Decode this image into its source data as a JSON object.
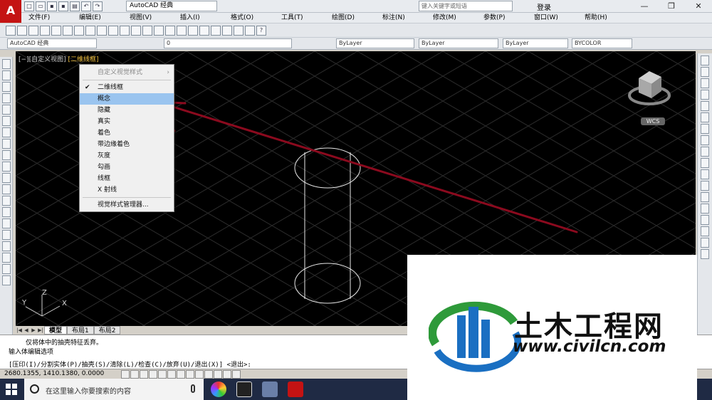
{
  "titlebar": {
    "app_logo": "A",
    "workspace": "AutoCAD 经典",
    "search_placeholder": "键入关键字或短语",
    "login": "登录"
  },
  "menubar": {
    "items": [
      "文件(F)",
      "编辑(E)",
      "视图(V)",
      "插入(I)",
      "格式(O)",
      "工具(T)",
      "绘图(D)",
      "标注(N)",
      "修改(M)",
      "参数(P)",
      "窗口(W)",
      "帮助(H)"
    ]
  },
  "toolbar2": {
    "workspace": "AutoCAD 经典",
    "layer": "0",
    "color": "ByLayer",
    "linetype": "ByLayer",
    "lineweight": "ByLayer",
    "plotstyle": "BYCOLOR"
  },
  "viewport": {
    "label_prefix": "[−][自定义视图]",
    "label_style": "[二维线框]",
    "wcs": "WCS",
    "axes": {
      "x": "X",
      "y": "Y",
      "z": "Z"
    }
  },
  "context_menu": {
    "header": "自定义视觉样式",
    "items": [
      "二维线框",
      "概念",
      "隐藏",
      "真实",
      "着色",
      "带边缘着色",
      "灰度",
      "勾画",
      "线框",
      "X 射线"
    ],
    "checked_index": 0,
    "highlight_index": 1,
    "manager": "视觉样式管理器..."
  },
  "layout_tabs": [
    "模型",
    "布局1",
    "布局2"
  ],
  "command": {
    "line1": "仅将体中的抽壳特征丢弃。",
    "line2": "输入体编辑选项",
    "prompt": "[压印(I)/分割实体(P)/抽壳(S)/清除(L)/检查(C)/放弃(U)/退出(X)] <退出>:"
  },
  "status": {
    "coords": "2680.1355, 1410.1380, 0.0000"
  },
  "taskbar": {
    "search_text": "在这里输入你要搜索的内容"
  },
  "watermark": {
    "name": "土木工程网",
    "url": "www.civilcn.com"
  },
  "colors": {
    "annotation_arrow": "#8b0a1e",
    "highlight": "#9ac4ef",
    "viewport_bg": "#000000",
    "logo_blue": "#1a6fc2",
    "logo_green": "#2e9a3a"
  }
}
